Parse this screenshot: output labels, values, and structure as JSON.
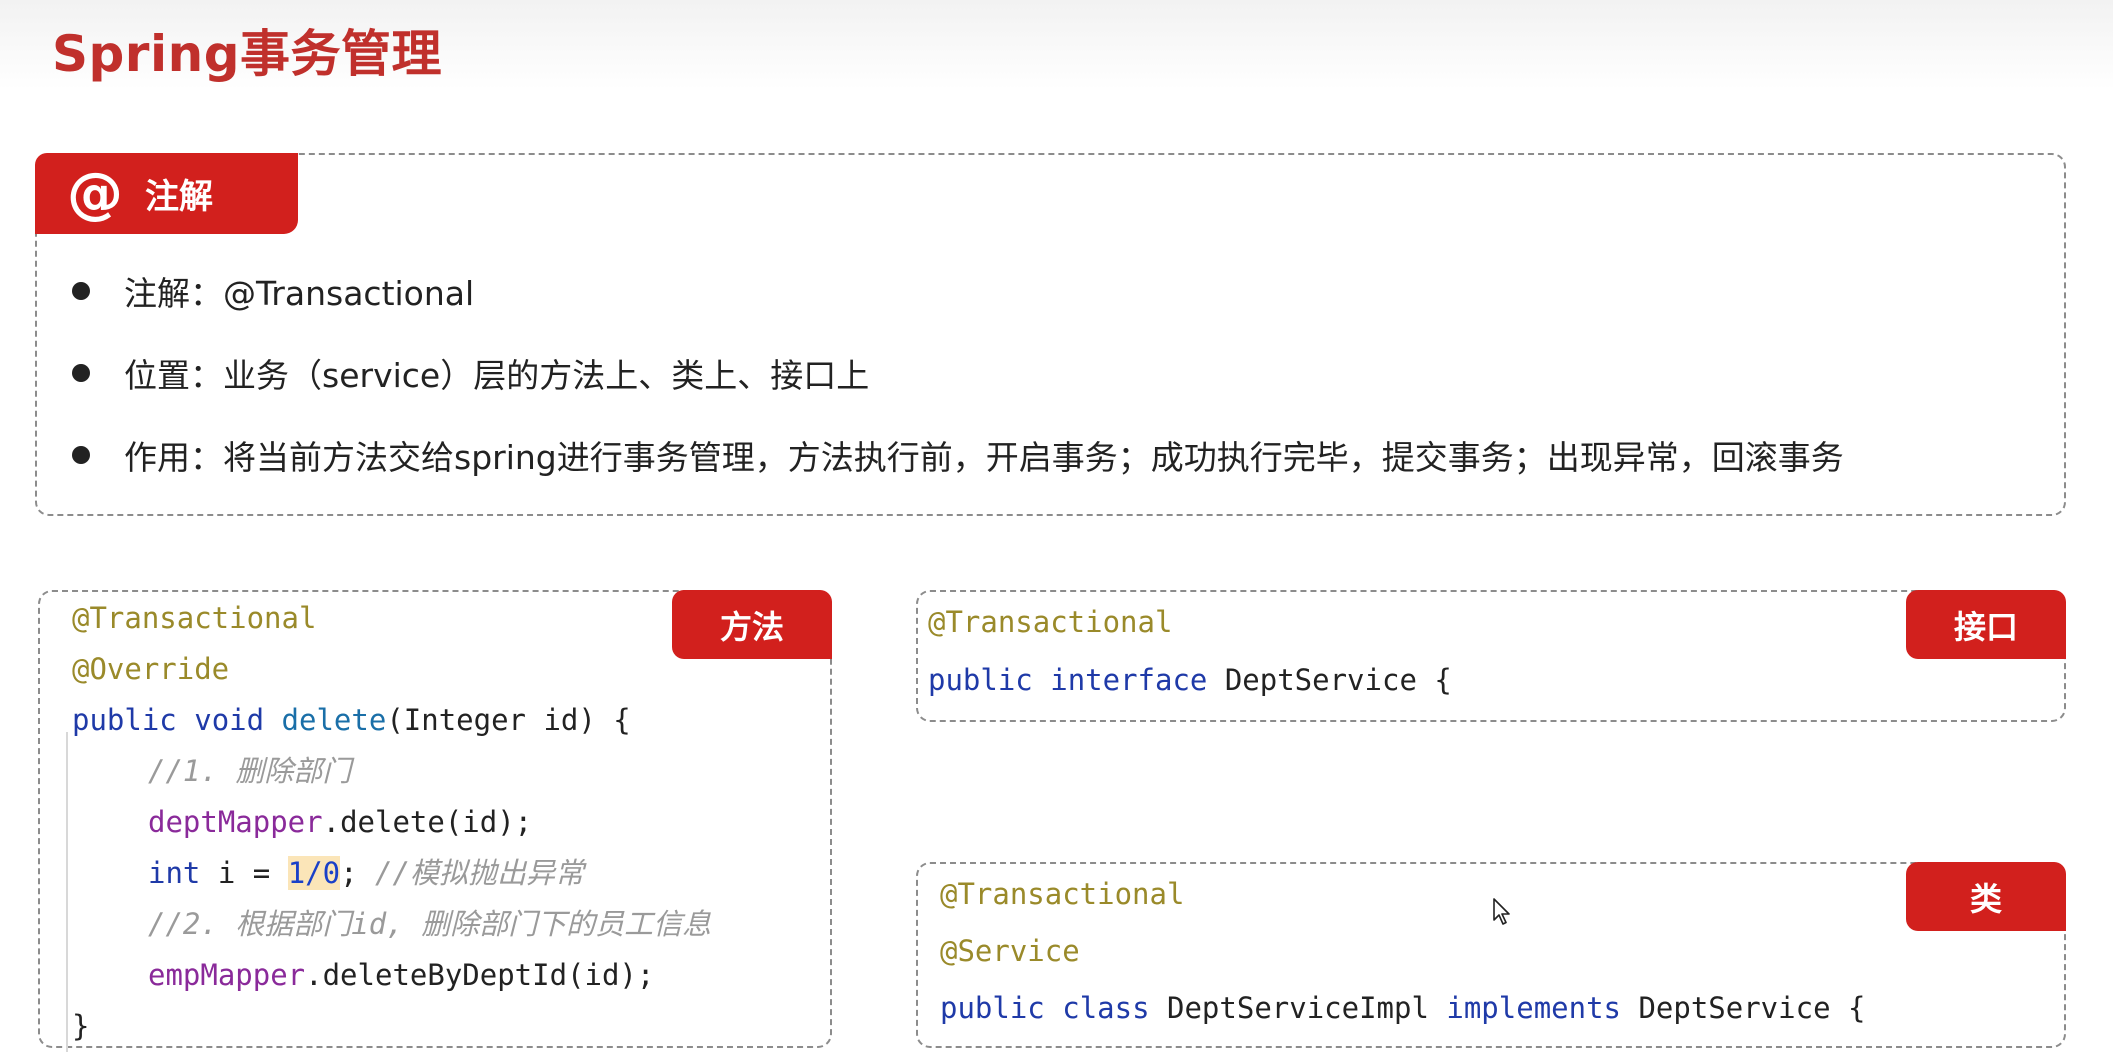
{
  "title": "Spring事务管理",
  "annotation_section": {
    "icon": "at-sign-icon",
    "icon_glyph": "@",
    "label": "注解",
    "bullets": [
      "注解：@Transactional",
      "位置：业务（service）层的方法上、类上、接口上",
      "作用：将当前方法交给spring进行事务管理，方法执行前，开启事务；成功执行完毕，提交事务；出现异常，回滚事务"
    ]
  },
  "method_example": {
    "tag": "方法",
    "lines": {
      "l1": "@Transactional",
      "l2": "@Override",
      "l3_kw1": "public",
      "l3_kw2": "void",
      "l3_fn": "delete",
      "l3_rest": "(Integer id) {",
      "l4": "//1. 删除部门",
      "l5_field": "deptMapper",
      "l5_rest": ".delete(id);",
      "l6_kw": "int",
      "l6_mid": " i = ",
      "l6_num": "1/0",
      "l6_semi": ";",
      "l6_cmt": "//模拟抛出异常",
      "l7": "//2. 根据部门id, 删除部门下的员工信息",
      "l8_field": "empMapper",
      "l8_rest": ".deleteByDeptId(id);",
      "l9": "}"
    }
  },
  "interface_example": {
    "tag": "接口",
    "lines": {
      "l1": "@Transactional",
      "l2_kw1": "public",
      "l2_kw2": "interface",
      "l2_rest": "DeptService {"
    }
  },
  "class_example": {
    "tag": "类",
    "lines": {
      "l1": "@Transactional",
      "l2": "@Service",
      "l3_kw1": "public",
      "l3_kw2": "class",
      "l3_name": "DeptServiceImpl",
      "l3_kw3": "implements",
      "l3_rest": "DeptService {"
    }
  },
  "cursor": "mouse-pointer-icon",
  "colors": {
    "accent": "#d2201d",
    "title": "#c0302c",
    "keyword": "#1f3aa8",
    "annotation": "#9a8a2a",
    "comment": "#9a9a9a",
    "field": "#8a2a9a"
  }
}
